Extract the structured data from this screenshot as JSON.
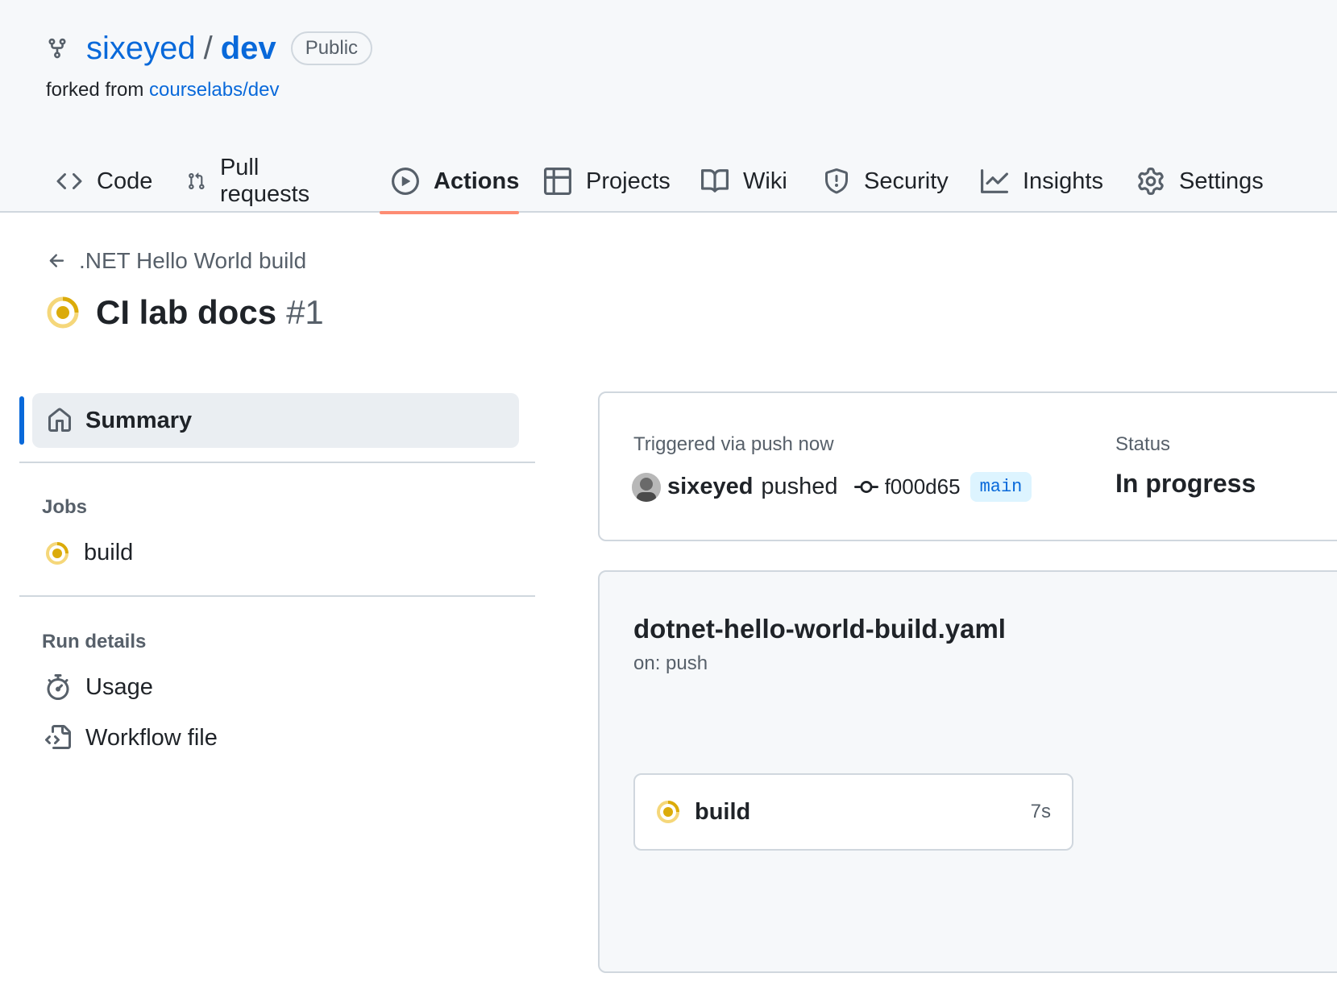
{
  "repo": {
    "owner": "sixeyed",
    "separator": "/",
    "name": "dev",
    "visibility": "Public",
    "forked_prefix": "forked from",
    "forked_source": "courselabs/dev"
  },
  "nav": {
    "tabs": [
      {
        "label": "Code",
        "icon": "code-icon"
      },
      {
        "label": "Pull requests",
        "icon": "git-pull-request-icon"
      },
      {
        "label": "Actions",
        "icon": "play-icon"
      },
      {
        "label": "Projects",
        "icon": "table-icon"
      },
      {
        "label": "Wiki",
        "icon": "book-icon"
      },
      {
        "label": "Security",
        "icon": "shield-icon"
      },
      {
        "label": "Insights",
        "icon": "graph-icon"
      },
      {
        "label": "Settings",
        "icon": "gear-icon"
      }
    ],
    "selected": "Actions"
  },
  "run": {
    "back_label": ".NET Hello World build",
    "title": "CI lab docs",
    "number": "#1",
    "status_icon": "in-progress-icon",
    "status_color": "#dbab0a"
  },
  "sidebar": {
    "summary_label": "Summary",
    "jobs_heading": "Jobs",
    "jobs": [
      {
        "label": "build"
      }
    ],
    "run_details_heading": "Run details",
    "details": [
      {
        "label": "Usage",
        "icon": "stopwatch-icon"
      },
      {
        "label": "Workflow file",
        "icon": "file-code-icon"
      }
    ]
  },
  "trigger": {
    "label": "Triggered via push now",
    "user": "sixeyed",
    "action": "pushed",
    "commit_sha": "f000d65",
    "branch": "main",
    "status_label": "Status",
    "status_value": "In progress"
  },
  "workflow": {
    "file_name": "dotnet-hello-world-build.yaml",
    "on": "on: push",
    "job_name": "build",
    "job_duration": "7s"
  },
  "colors": {
    "link": "#0969da",
    "accent_underline": "#fd8c73",
    "in_progress": "#dbab0a"
  }
}
